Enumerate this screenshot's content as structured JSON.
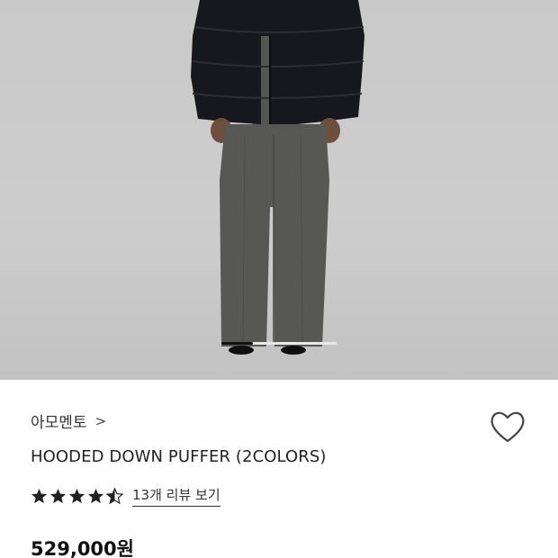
{
  "gallery": {
    "image_description": "model wearing black puffer jacket and grey wide trousers",
    "progress_fraction": 0.27
  },
  "product": {
    "brand": "아모멘토",
    "brand_chevron": ">",
    "name": "HOODED DOWN PUFFER (2COLORS)",
    "rating": 4.5,
    "review_link": "13개 리뷰 보기",
    "price": "529,000원"
  },
  "icons": {
    "wishlist": "heart-outline-icon",
    "star": "star-icon"
  },
  "colors": {
    "star": "#222222",
    "price": "#111111",
    "background": "#c9c9c9"
  }
}
